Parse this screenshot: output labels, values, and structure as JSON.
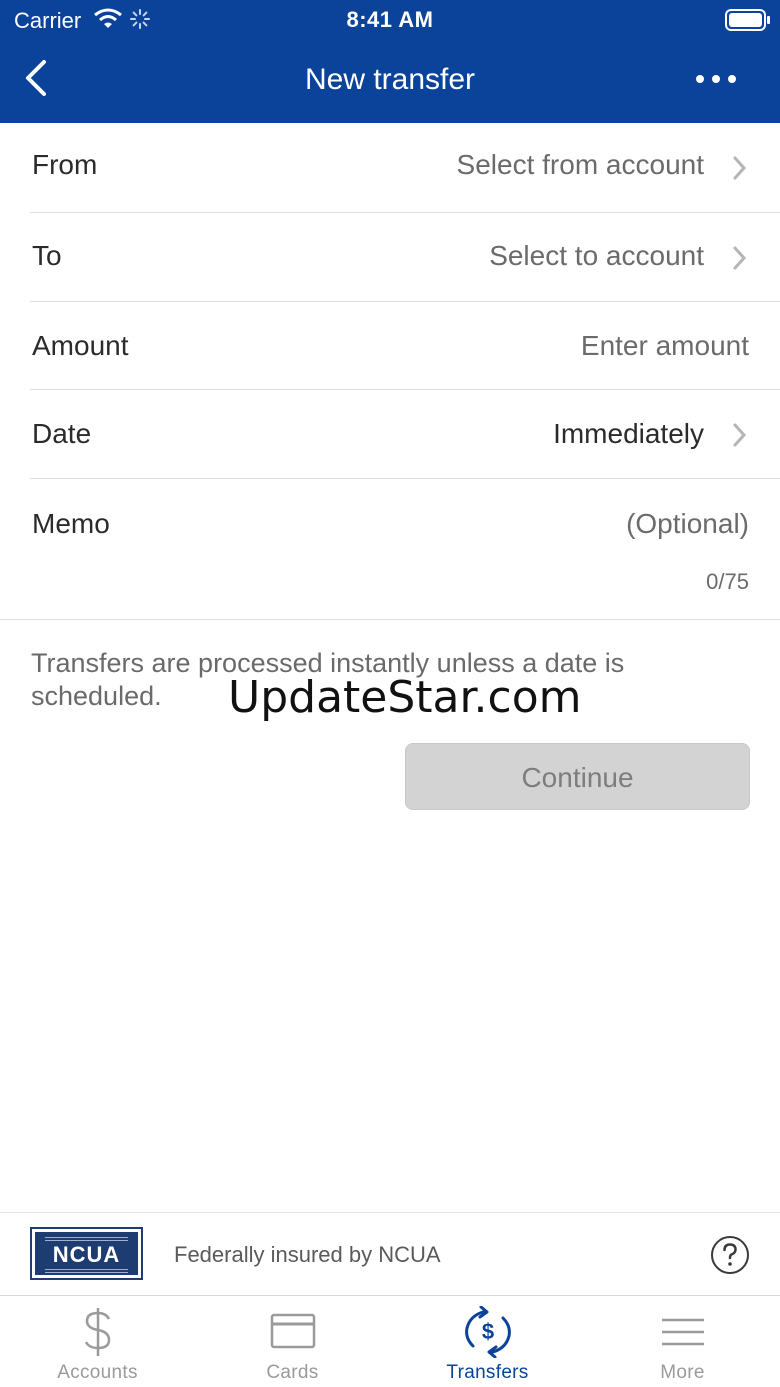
{
  "status_bar": {
    "carrier": "Carrier",
    "time": "8:41 AM"
  },
  "nav": {
    "title": "New transfer",
    "back_icon": "chevron-left-icon",
    "menu_icon": "more-horizontal-icon"
  },
  "form": {
    "from": {
      "label": "From",
      "value": "Select from account"
    },
    "to": {
      "label": "To",
      "value": "Select to account"
    },
    "amount": {
      "label": "Amount",
      "placeholder": "Enter amount"
    },
    "date": {
      "label": "Date",
      "value": "Immediately"
    },
    "memo": {
      "label": "Memo",
      "placeholder": "(Optional)",
      "counter": "0/75"
    }
  },
  "note": "Transfers are processed instantly unless a date is scheduled.",
  "watermark": "UpdateStar.com",
  "continue_label": "Continue",
  "ncua": {
    "logo_text": "NCUA",
    "caption": "Federally insured by NCUA"
  },
  "tabs": [
    {
      "label": "Accounts",
      "icon": "dollar-icon",
      "active": false
    },
    {
      "label": "Cards",
      "icon": "card-icon",
      "active": false
    },
    {
      "label": "Transfers",
      "icon": "transfer-dollar-icon",
      "active": true
    },
    {
      "label": "More",
      "icon": "hamburger-menu-icon",
      "active": false
    }
  ],
  "colors": {
    "brand": "#0a4399",
    "disabled_button": "#d3d3d3"
  }
}
